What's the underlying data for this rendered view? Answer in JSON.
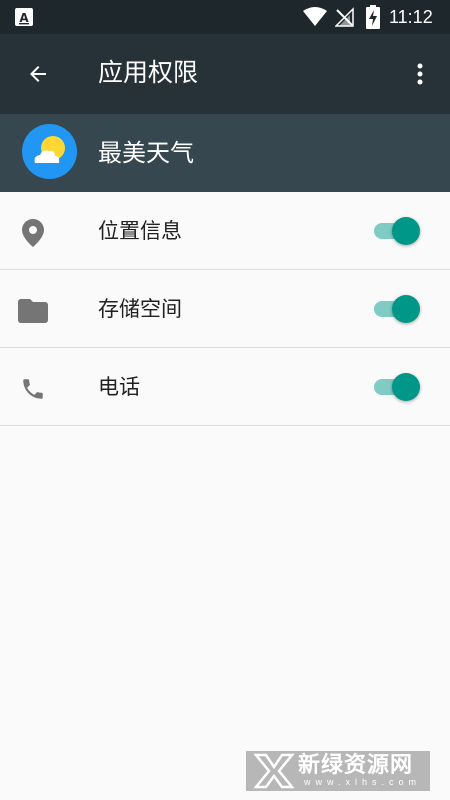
{
  "status_bar": {
    "time": "11:12",
    "icons": [
      "notification-a-icon",
      "wifi-icon",
      "no-signal-icon",
      "battery-charging-icon"
    ]
  },
  "toolbar": {
    "title": "应用权限",
    "back_icon": "arrow-back-icon",
    "more_icon": "more-vert-icon"
  },
  "app_header": {
    "name": "最美天气",
    "icon": "weather-app-icon",
    "colors": {
      "icon_bg": "#2196f3",
      "sun": "#fdd835",
      "cloud": "#ffffff"
    }
  },
  "permissions": [
    {
      "label": "位置信息",
      "icon": "location-pin-icon",
      "enabled": true
    },
    {
      "label": "存储空间",
      "icon": "folder-icon",
      "enabled": true
    },
    {
      "label": "电话",
      "icon": "phone-icon",
      "enabled": true
    }
  ],
  "colors": {
    "status_bar": "#1e272c",
    "toolbar": "#263238",
    "app_header": "#37474f",
    "accent": "#009688",
    "accent_track": "#80cbc4",
    "background": "#fafafa"
  },
  "watermark": {
    "text": "新绿资源网",
    "subtext": "www.xlhs.com"
  }
}
